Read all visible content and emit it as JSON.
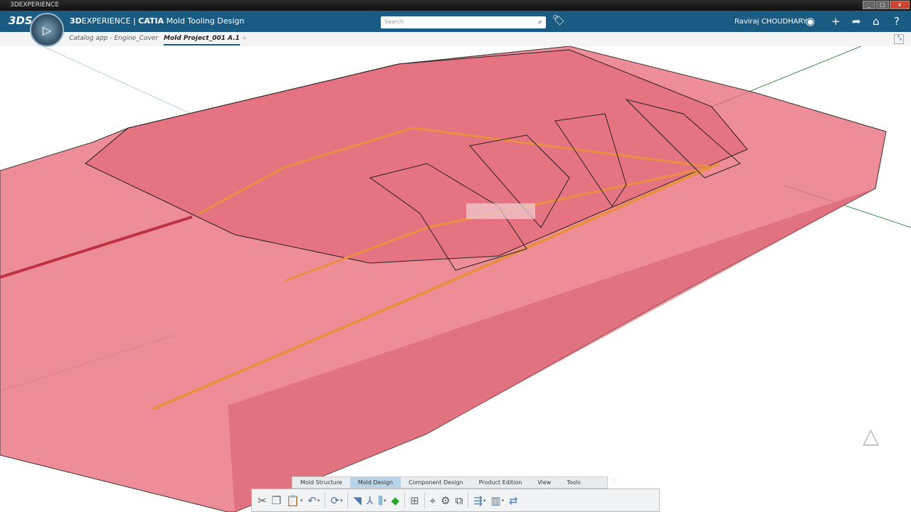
{
  "window": {
    "title": "3DEXPERIENCE",
    "controls": [
      "_",
      "□",
      "x"
    ]
  },
  "header": {
    "brand": "3D",
    "brand_rest": "EXPERIENCE | ",
    "app_bold": "CATIA",
    "app_name": " Mold Tooling Design",
    "search_placeholder": "Search",
    "user": "Raviraj CHOUDHARY"
  },
  "tabs": [
    {
      "label": "Catalog app - Engine_Cover"
    },
    {
      "label": "Mold Project_001 A.1",
      "active": true
    },
    {
      "label": "+"
    }
  ],
  "ribbon": {
    "tabs": [
      "Mold Structure",
      "Mold Design",
      "Component Design",
      "Product Edition",
      "View",
      "Tools"
    ],
    "active": "Mold Design"
  },
  "toolbar": {
    "icons": [
      "cut-icon",
      "copy-icon",
      "paste-icon",
      "undo-icon",
      "update-icon",
      "parting-icon",
      "split-icon",
      "pins-icon",
      "draft-analysis-icon",
      "insert-component-icon",
      "axis-system-icon",
      "assembly-icon",
      "replace-icon",
      "feature-icon",
      "component-icon",
      "exchange-icon"
    ]
  },
  "colors": {
    "header": "#1a5b84",
    "model": "#e8707e",
    "highlight": "#e89040"
  }
}
